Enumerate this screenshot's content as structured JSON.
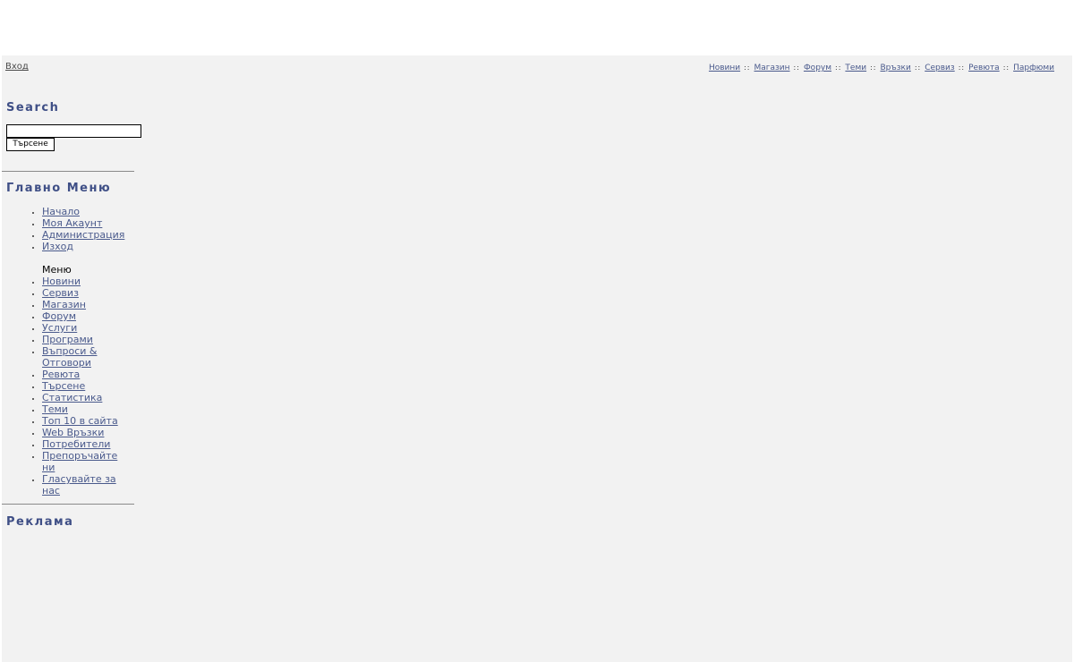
{
  "header": {
    "login_label": "Вход",
    "nav": [
      "Новини",
      "Магазин",
      "Форум",
      "Теми",
      "Връзки",
      "Сервиз",
      "Ревюта",
      "Парфюми"
    ],
    "separator": "::"
  },
  "search": {
    "title": "Search",
    "input_value": "",
    "button_label": "Търсене"
  },
  "main_menu": {
    "title": "Главно Меню",
    "account_items": [
      "Начало",
      "Моя Акаунт",
      "Администрация",
      "Изход"
    ],
    "sub_label": "Меню",
    "items": [
      "Новини",
      "Сервиз",
      "Магазин",
      "Форум",
      "Услуги",
      "Програми",
      "Въпроси & Отговори",
      "Ревюта",
      "Търсене",
      "Статистика",
      "Теми",
      "Топ 10 в сайта",
      "Web Връзки",
      "Потребители",
      "Препоръчайте ни",
      "Гласувайте за нас"
    ]
  },
  "ads": {
    "title": "Реклама"
  },
  "colors": {
    "link": "#4a5a8c",
    "title": "#3f4f86",
    "background": "#f2f2f2"
  }
}
